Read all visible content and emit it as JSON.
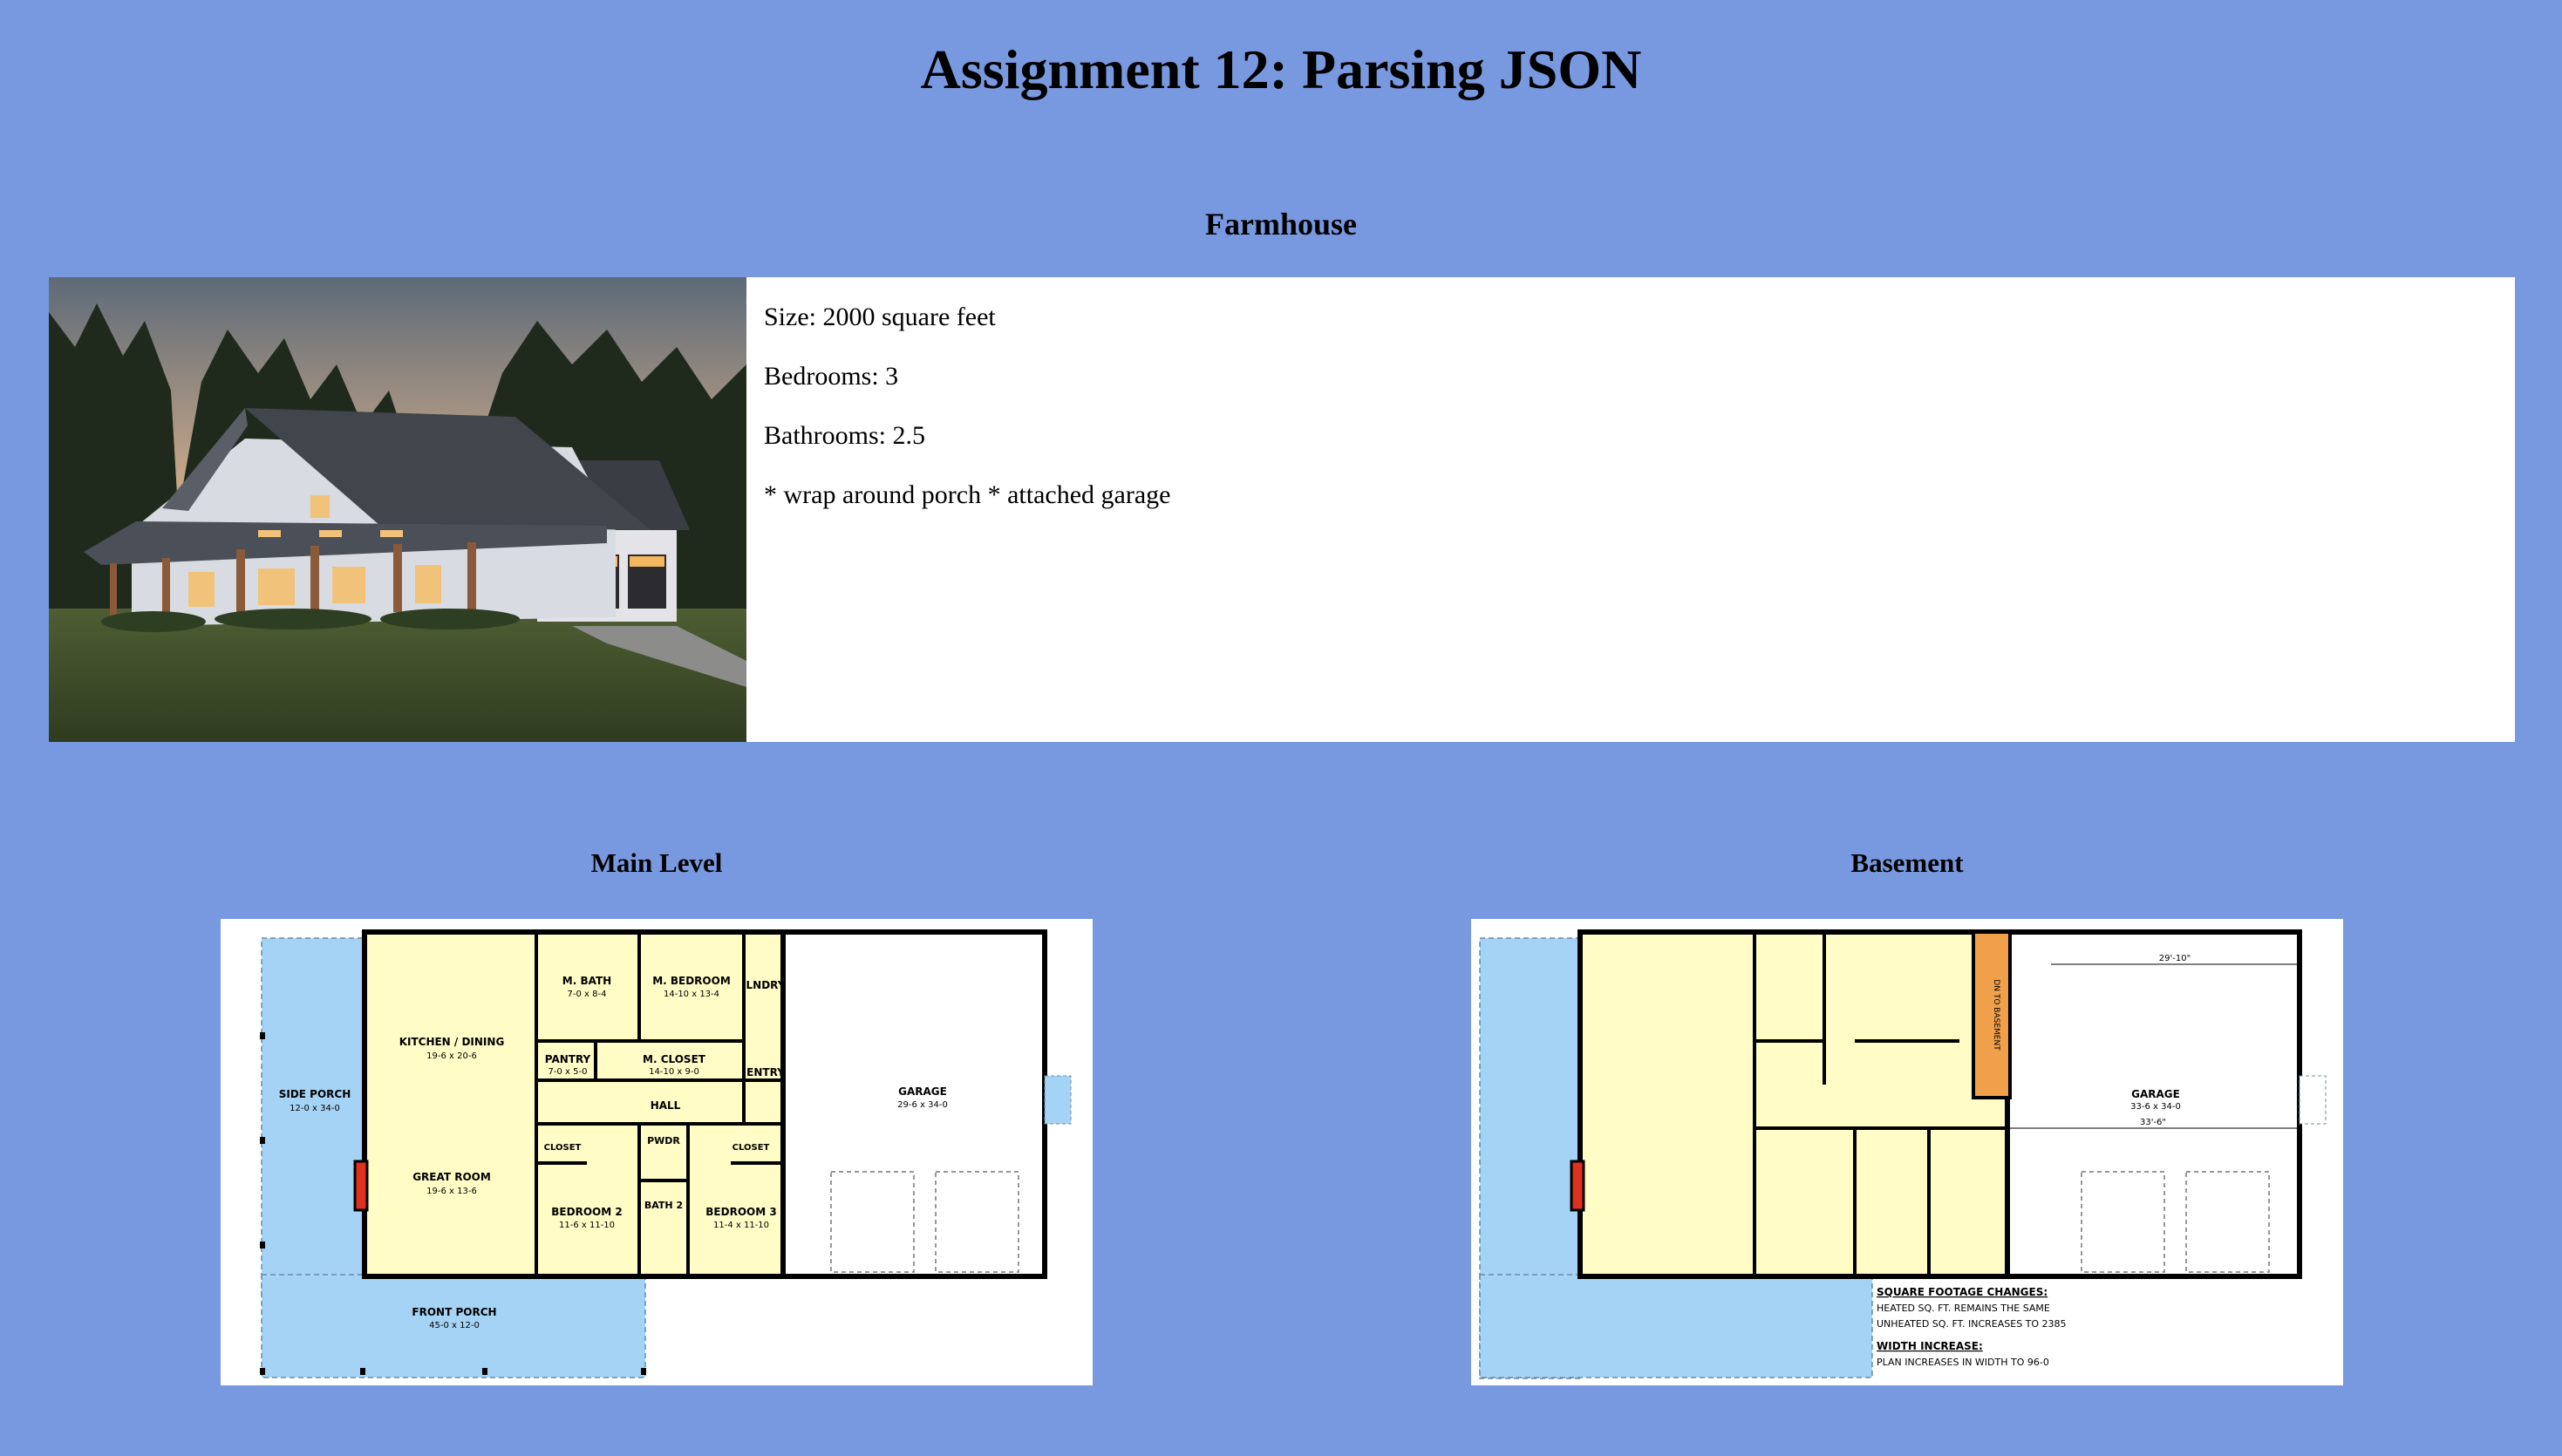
{
  "page": {
    "title": "Assignment 12: Parsing JSON"
  },
  "house": {
    "name": "Farmhouse",
    "size": "Size: 2000 square feet",
    "bedrooms": "Bedrooms: 3",
    "bathrooms": "Bathrooms: 2.5",
    "features": "* wrap around porch * attached garage",
    "photo": "farmhouse exterior rendering at dusk"
  },
  "main_level": {
    "title": "Main Level",
    "rooms": {
      "side_porch": "SIDE PORCH",
      "side_porch_dim": "12-0 x 34-0",
      "kitchen": "KITCHEN / DINING",
      "kitchen_dim": "19-6 x 20-6",
      "great_room": "GREAT ROOM",
      "great_room_dim": "19-6 x 13-6",
      "m_bath": "M. BATH",
      "m_bath_dim": "7-0 x 8-4",
      "m_bedroom": "M. BEDROOM",
      "m_bedroom_dim": "14-10 x 13-4",
      "lndry": "LNDRY",
      "pantry": "PANTRY",
      "pantry_dim": "7-0 x 5-0",
      "m_closet": "M. CLOSET",
      "m_closet_dim": "14-10 x 9-0",
      "entry": "ENTRY",
      "hall": "HALL",
      "closet": "CLOSET",
      "pwdr": "PWDR",
      "bath2": "BATH 2",
      "bedroom2": "BEDROOM 2",
      "bedroom2_dim": "11-6 x 11-10",
      "bedroom3": "BEDROOM 3",
      "bedroom3_dim": "11-4 x 11-10",
      "garage": "GARAGE",
      "garage_dim": "29-6 x 34-0",
      "front_porch": "FRONT PORCH",
      "front_porch_dim": "45-0 x 12-0"
    }
  },
  "basement": {
    "title": "Basement",
    "rooms": {
      "garage": "GARAGE",
      "garage_dim": "33-6 x 34-0",
      "dim_top": "29'-10\"",
      "dim_mid": "33'-6\"",
      "stair": "DN TO BASEMENT"
    },
    "notes": {
      "sq_heading": "SQUARE FOOTAGE CHANGES:",
      "sq_line1": "HEATED SQ. FT. REMAINS THE SAME",
      "sq_line2": "UNHEATED SQ. FT. INCREASES TO 2385",
      "width_heading": "WIDTH INCREASE:",
      "width_line1": "PLAN INCREASES IN WIDTH TO 96-0"
    }
  },
  "colors": {
    "background": "#7899e0",
    "plan_fill": "#fffcc6",
    "porch_fill": "#a5d3f5",
    "fireplace": "#e0301e",
    "stair": "#f0a04b"
  }
}
